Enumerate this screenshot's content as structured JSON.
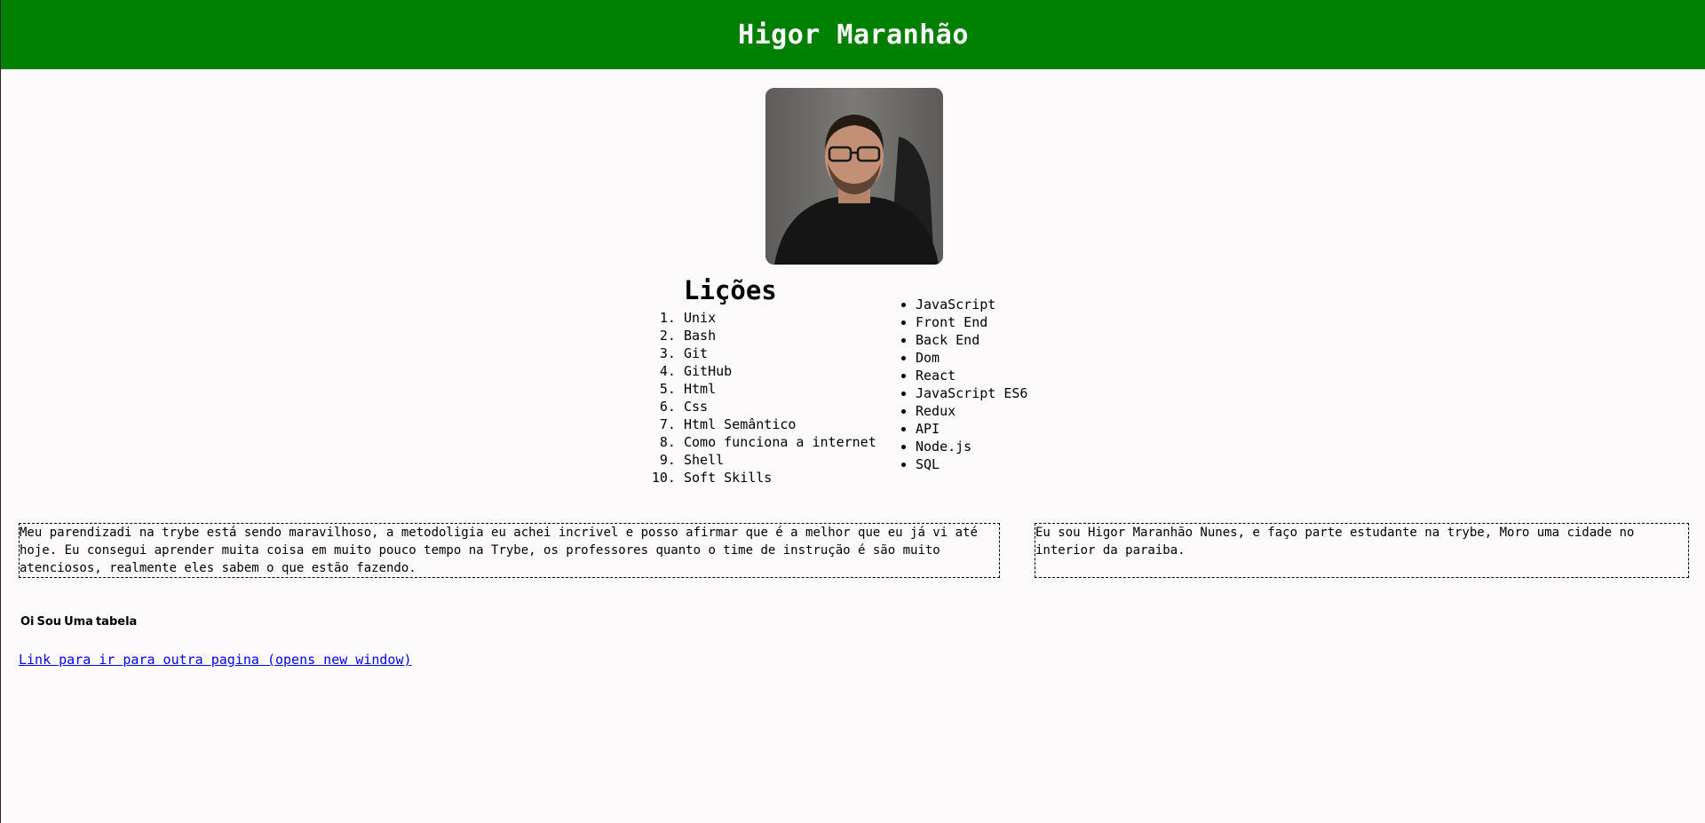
{
  "header": {
    "title": "Higor Maranhão"
  },
  "profile": {
    "photo_icon": "profile-photo"
  },
  "licoes": {
    "title": "Lições",
    "items": [
      "Unix",
      "Bash",
      "Git",
      "GitHub",
      "Html",
      "Css",
      "Html Semântico",
      "Como funciona a internet",
      "Shell",
      "Soft Skills"
    ]
  },
  "skills": {
    "items": [
      "JavaScript",
      "Front End",
      "Back End",
      "Dom",
      "React",
      "JavaScript ES6",
      "Redux",
      "API",
      "Node.js",
      "SQL"
    ]
  },
  "boxes": {
    "left": "Meu parendizadi na trybe está sendo maravilhoso, a metodoligia eu achei incrivel e posso afirmar que é a melhor que eu já vi até hoje. Eu consegui aprender muita coisa em muito pouco tempo na Trybe, os professores quanto o time de instrução é são muito atenciosos, realmente eles sabem o que estão fazendo.",
    "right": "Eu sou Higor Maranhão Nunes, e faço parte estudante na trybe, Moro uma cidade no interior da paraiba."
  },
  "tabela": {
    "cells": [
      "Oi",
      "Sou",
      "Uma",
      "tabela"
    ]
  },
  "link": {
    "text": "Link para ir para outra pagina (opens new window)"
  },
  "colors": {
    "header_bg": "#008000",
    "header_text": "#ffffff",
    "page_bg": "#fdfafb",
    "link": "#0000ee"
  }
}
